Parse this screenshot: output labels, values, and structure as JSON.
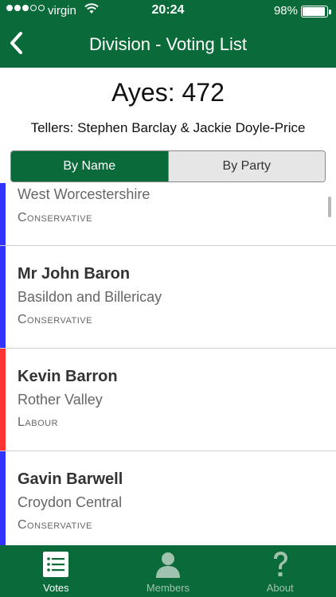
{
  "status_bar": {
    "carrier": "virgin",
    "time": "20:24",
    "battery": "98%"
  },
  "nav": {
    "title": "Division - Voting List"
  },
  "header": {
    "ayes": "Ayes: 472",
    "tellers": "Tellers: Stephen Barclay & Jackie Doyle-Price"
  },
  "segments": {
    "by_name": "By Name",
    "by_party": "By Party"
  },
  "members": [
    {
      "name": "",
      "constituency": "West Worcestershire",
      "party": "Conservative",
      "color": "#3333ff"
    },
    {
      "name": "Mr John Baron",
      "constituency": "Basildon and Billericay",
      "party": "Conservative",
      "color": "#3333ff"
    },
    {
      "name": "Kevin Barron",
      "constituency": "Rother Valley",
      "party": "Labour",
      "color": "#ff3333"
    },
    {
      "name": "Gavin Barwell",
      "constituency": "Croydon Central",
      "party": "Conservative",
      "color": "#3333ff"
    }
  ],
  "tabs": {
    "votes": "Votes",
    "members": "Members",
    "about": "About"
  },
  "colors": {
    "brand_green": "#0b6a3a",
    "conservative": "#3333ff",
    "labour": "#ff3333"
  }
}
